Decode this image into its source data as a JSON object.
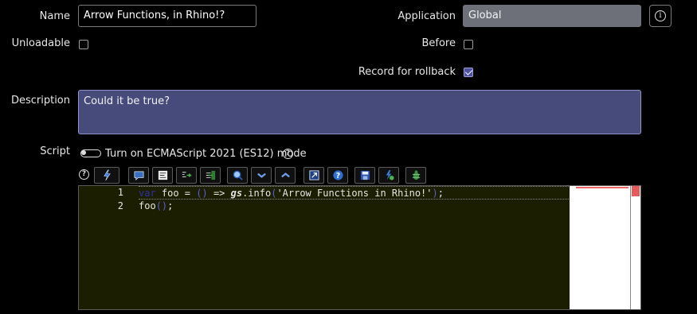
{
  "form": {
    "name_label": "Name",
    "name_value": "Arrow Functions, in Rhino!?",
    "application_label": "Application",
    "application_value": "Global",
    "unloadable_label": "Unloadable",
    "before_label": "Before",
    "record_label": "Record for rollback",
    "unloadable_checked": false,
    "before_checked": false,
    "record_checked": true,
    "description_label": "Description",
    "description_value": "Could it be true?",
    "script_label": "Script",
    "es_toggle_label": "Turn on ECMAScript 2021 (ES12) mode"
  },
  "toolbar": {
    "icons": [
      "script-include-icon",
      "comment-icon",
      "format-code-icon",
      "replace-icon",
      "replace-all-icon",
      "search-icon",
      "fold-icon",
      "unfold-icon",
      "fullscreen-icon",
      "help-icon",
      "save-icon",
      "script-debugger-icon",
      "syntax-check-icon"
    ]
  },
  "editor": {
    "line_numbers": [
      "1",
      "2"
    ],
    "line1": {
      "kw": "var",
      "a": " foo = ",
      "p1": "()",
      "b": " => ",
      "gs": "gs",
      "c": ".info",
      "p2": "(",
      "str": "'Arrow Functions in Rhino!'",
      "p3": ")",
      "d": ";"
    },
    "line2": {
      "a": "foo",
      "p1": "()",
      "d": ";"
    }
  },
  "colors": {
    "accent": "#4f52a0",
    "description_bg": "#474b7c",
    "editor_bg": "#1c1e00",
    "readonly_field": "#6d7079"
  }
}
